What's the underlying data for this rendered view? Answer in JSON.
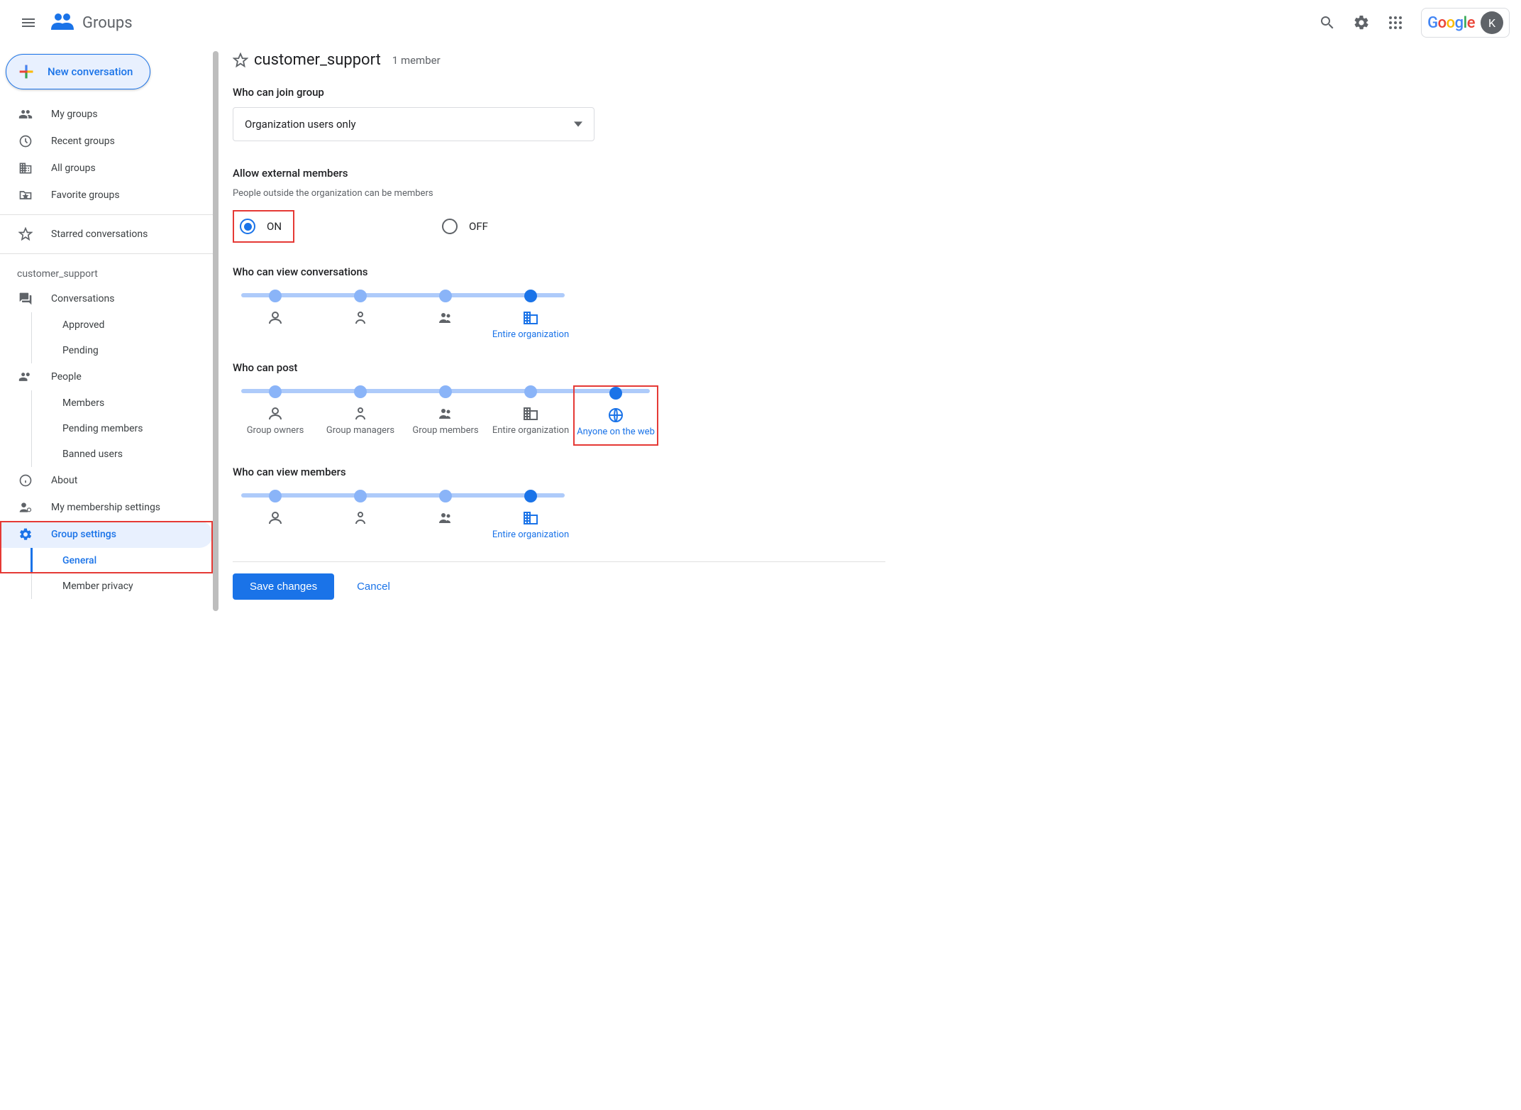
{
  "header": {
    "app_name": "Groups",
    "google_label": "Google",
    "avatar_initial": "K"
  },
  "sidebar": {
    "new_conversation": "New conversation",
    "items": {
      "my_groups": "My groups",
      "recent_groups": "Recent groups",
      "all_groups": "All groups",
      "favorite_groups": "Favorite groups",
      "starred": "Starred conversations"
    },
    "group_label": "customer_support",
    "group_nav": {
      "conversations": "Conversations",
      "approved": "Approved",
      "pending": "Pending",
      "people": "People",
      "members": "Members",
      "pending_members": "Pending members",
      "banned_users": "Banned users",
      "about": "About",
      "membership_settings": "My membership settings",
      "group_settings": "Group settings",
      "general": "General",
      "member_privacy": "Member privacy"
    }
  },
  "main": {
    "group_name": "customer_support",
    "member_count": "1 member",
    "who_can_join": {
      "label": "Who can join group",
      "value": "Organization users only"
    },
    "allow_external": {
      "label": "Allow external members",
      "sublabel": "People outside the organization can be members",
      "on": "ON",
      "off": "OFF",
      "selected": "on"
    },
    "view_conversations": {
      "label": "Who can view conversations",
      "selected_index": 3,
      "stops": [
        {
          "label": ""
        },
        {
          "label": ""
        },
        {
          "label": ""
        },
        {
          "label": "Entire organization"
        }
      ]
    },
    "who_can_post": {
      "label": "Who can post",
      "selected_index": 4,
      "stops": [
        {
          "label": "Group owners"
        },
        {
          "label": "Group managers"
        },
        {
          "label": "Group members"
        },
        {
          "label": "Entire organization"
        },
        {
          "label": "Anyone on the web"
        }
      ]
    },
    "view_members": {
      "label": "Who can view members",
      "selected_index": 3,
      "stops": [
        {
          "label": ""
        },
        {
          "label": ""
        },
        {
          "label": ""
        },
        {
          "label": "Entire organization"
        }
      ]
    },
    "footer": {
      "save": "Save changes",
      "cancel": "Cancel"
    }
  }
}
